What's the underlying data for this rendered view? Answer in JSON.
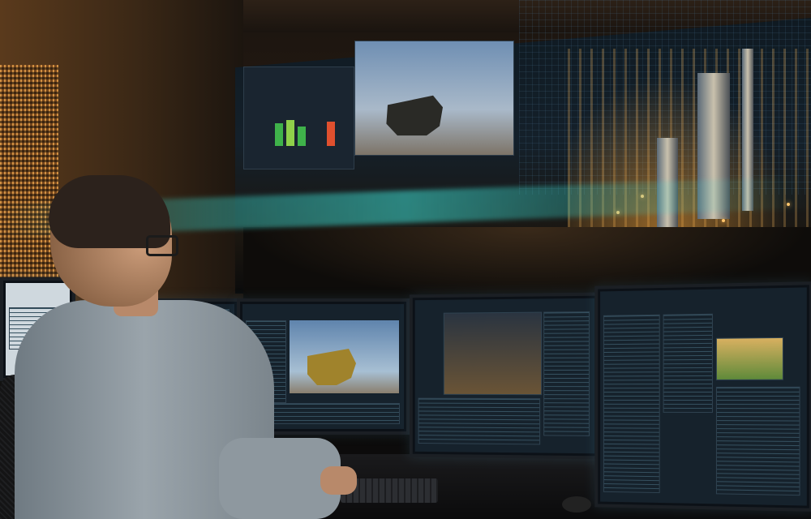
{
  "scene": {
    "setting": "control-room",
    "colors": {
      "accent_glow": "#3cdcd2",
      "warm_light": "#ffb24a",
      "screen_bg": "#16222c"
    },
    "video_wall": {
      "status_bars": [
        {
          "color": "#3fb24a",
          "level": 0.7
        },
        {
          "color": "#8fd04a",
          "level": 0.8
        },
        {
          "color": "#3fb24a",
          "level": 0.6
        },
        {
          "color": "#e0502e",
          "level": 0.75
        }
      ]
    }
  }
}
